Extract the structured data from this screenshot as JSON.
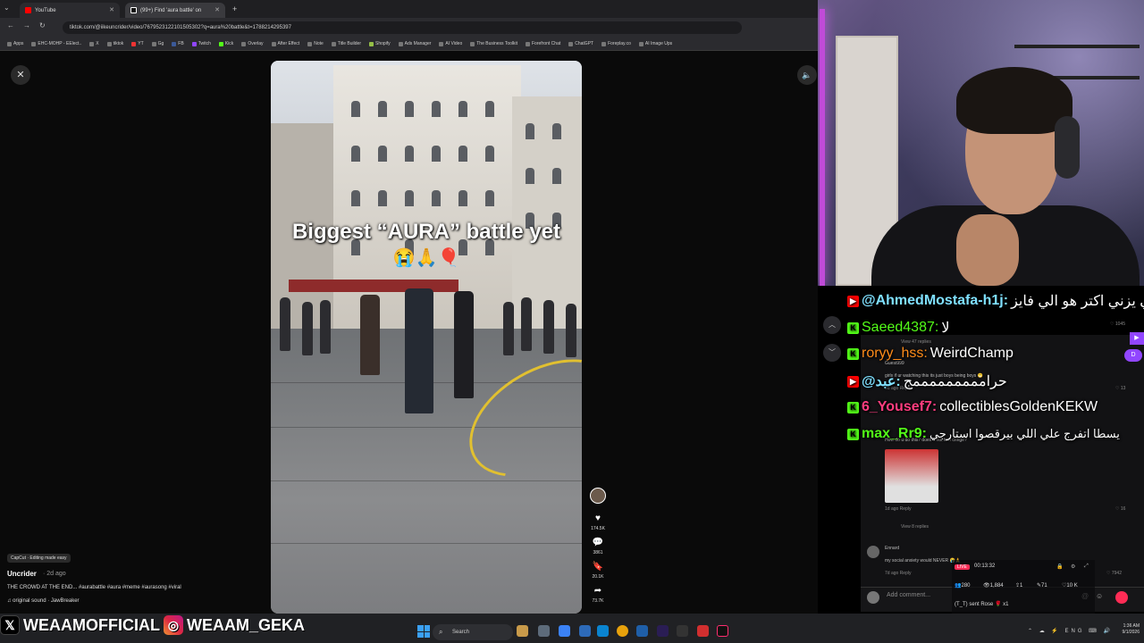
{
  "browser": {
    "tabs": [
      {
        "label": "YouTube",
        "color": "#ff0000"
      },
      {
        "label": "(99+) Find 'aura battle' on",
        "color": "#ffffff"
      }
    ],
    "new_tab": "+",
    "url": "tiktok.com/@iikeuncrider/video/7679523122101505302?q=aura%20battle&t=1788214295397",
    "bookmarks": [
      "Apps",
      "EHC-MOHP - EElect..",
      "X",
      "tiktok",
      "YT",
      "Gg",
      "FB",
      "Twitch",
      "Kick",
      "Overlay",
      "After Effect",
      "Note",
      "Title Builder",
      "Shopify",
      "Ads Manager",
      "AI Video",
      "The Business Toolkit",
      "Forefront Chat",
      "ChatGPT",
      "Foreplay.co",
      "AI Image Ups"
    ]
  },
  "video": {
    "caption": "Biggest “AURA” battle yet",
    "emojis": "😭🙏🎈"
  },
  "rail": {
    "likes": "174.5K",
    "comments": "3861",
    "saves": "20.1K",
    "shares": "73.7K"
  },
  "post": {
    "capcut": "CapCut · Editing made easy",
    "author": "Uncrider",
    "time": "· 2d ago",
    "description": "THE CROWD AT THE END... #aurabattle #aura #meme #aurasong #viral",
    "sound": "original sound · JawBreaker"
  },
  "comments_bg": {
    "c1_count": "1045",
    "view1": "View 47 replies",
    "c2_user": "Guest999",
    "c2_text": "girls if ur watching this its just boys being boys 😁",
    "c2_meta": "5d ago  Reply",
    "c2_count": "13",
    "c3_text": "How do u do this? does it not feel cringe?",
    "c3_meta": "1d ago  Reply",
    "c3_count": "16",
    "view2": "View 8 replies",
    "c4_user": "Ennard",
    "c4_text": "my social anxiety would NEVER 😭🙏",
    "c4_meta": "7d ago  Reply",
    "c4_count": "7942",
    "add_comment": "Add comment..."
  },
  "live": {
    "badge": "LIVE",
    "time": "00:13:32",
    "stats": [
      "280",
      "1,884",
      "1",
      "71",
      "10 K"
    ],
    "gift": "(T_T) sent Rose 🌹 x1"
  },
  "chat": [
    {
      "platform": "yt",
      "user": "@AhmedMostafa-h1j:",
      "color": "#7fe0ff",
      "msg": "الي يزني اكتر هو الي فايز"
    },
    {
      "platform": "kick",
      "user": "Saeed4387:",
      "color": "#53fc18",
      "msg": "لا"
    },
    {
      "platform": "kick",
      "user": "roryy_hss:",
      "color": "#ff8c1a",
      "msg": "WeirdChamp"
    },
    {
      "platform": "yt",
      "user": "@ﻋﺒﺪ:",
      "color": "#7fe0ff",
      "msg": "حرامممممممممج"
    },
    {
      "platform": "kick",
      "user": "6_Yousef7:",
      "color": "#ff3d7f",
      "msg": "collectiblesGoldenKEKW"
    },
    {
      "platform": "kick",
      "user": "max_Rr9:",
      "color": "#53fc18",
      "msg": "يسطا اتفرج علي اللي بيرقصوا استارجي"
    }
  ],
  "branding": {
    "x_handle": "WEAAMOFFICIAL",
    "ig_handle": "WEAAM_GEKA"
  },
  "taskbar": {
    "search": "Search",
    "time": "1:36 AM",
    "date": "9/1/2026",
    "lang": "ENG"
  }
}
